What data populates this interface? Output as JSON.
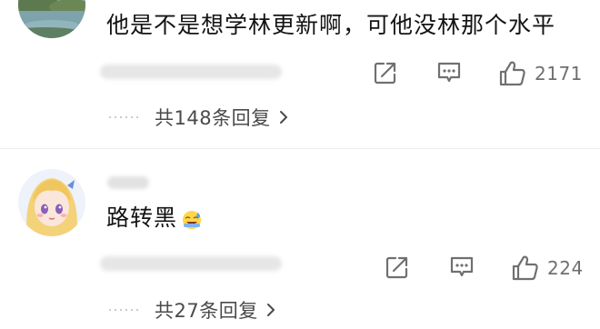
{
  "comments": [
    {
      "text": "他是不是想学林更新啊，可他没林那个水平",
      "likes": "2171",
      "replies_label": "共148条回复",
      "avatar": "landscape-lake-avatar"
    },
    {
      "text": "路转黑",
      "likes": "224",
      "replies_label": "共27条回复",
      "avatar": "anime-girl-avatar",
      "emoji": "sweat-smile-emoji"
    }
  ],
  "icons": {
    "share": "share-icon",
    "comment": "comment-icon",
    "like": "thumbs-up-icon",
    "chevron": "chevron-right-icon"
  },
  "colors": {
    "text": "#141414",
    "muted": "#6f6f6f",
    "replies": "#4a4a4a"
  }
}
